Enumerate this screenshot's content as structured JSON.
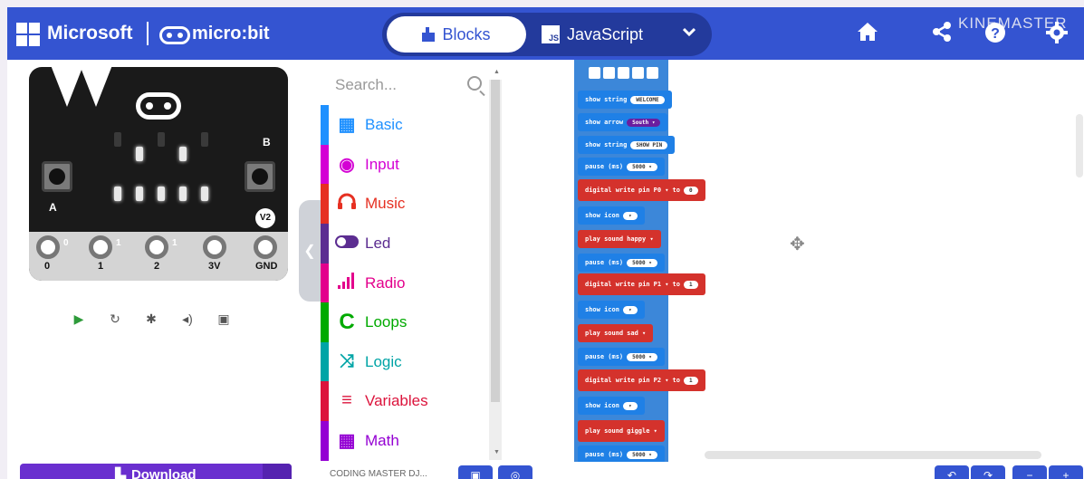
{
  "header": {
    "microsoft_label": "Microsoft",
    "microbit_label": "micro:bit",
    "tab_blocks": "Blocks",
    "tab_javascript": "JavaScript",
    "js_badge": "JS",
    "watermark": "KINEMASTER",
    "icons": [
      "home-icon",
      "share-icon",
      "help-icon",
      "settings-icon"
    ]
  },
  "simulator": {
    "btn_a": "A",
    "btn_b": "B",
    "version": "V2",
    "pins": [
      "0",
      "1",
      "2",
      "3V",
      "GND"
    ],
    "pin_small": [
      "0",
      "1",
      "1"
    ]
  },
  "toolbox": {
    "search_placeholder": "Search...",
    "categories": [
      {
        "label": "Basic",
        "color": "#1e90ff"
      },
      {
        "label": "Input",
        "color": "#d400d4"
      },
      {
        "label": "Music",
        "color": "#e63022"
      },
      {
        "label": "Led",
        "color": "#5c2d91"
      },
      {
        "label": "Radio",
        "color": "#e3008c"
      },
      {
        "label": "Loops",
        "color": "#00aa00"
      },
      {
        "label": "Logic",
        "color": "#00a4a6"
      },
      {
        "label": "Variables",
        "color": "#dc143c"
      },
      {
        "label": "Math",
        "color": "#9400d3"
      }
    ]
  },
  "workspace": {
    "blocks": [
      {
        "text": "show string",
        "value": "WELCOME"
      },
      {
        "text": "show arrow",
        "value": "South ▾"
      },
      {
        "text": "show string",
        "value": "SHOW PIN"
      },
      {
        "text": "pause (ms)",
        "value": "5000 ▾"
      },
      {
        "text": "digital write pin",
        "pin": "P0 ▾",
        "to": "to",
        "value": "0"
      },
      {
        "text": "show icon",
        "value": "▾"
      },
      {
        "text": "play sound",
        "value": "happy ▾"
      },
      {
        "text": "pause (ms)",
        "value": "5000 ▾"
      },
      {
        "text": "digital write pin",
        "pin": "P1 ▾",
        "to": "to",
        "value": "1"
      },
      {
        "text": "show icon",
        "value": "▾"
      },
      {
        "text": "play sound",
        "value": "sad ▾"
      },
      {
        "text": "pause (ms)",
        "value": "5000 ▾"
      },
      {
        "text": "digital write pin",
        "pin": "P2 ▾",
        "to": "to",
        "value": "1"
      },
      {
        "text": "show icon",
        "value": "▾"
      },
      {
        "text": "play sound",
        "value": "giggle ▾"
      },
      {
        "text": "pause (ms)",
        "value": "5000 ▾"
      }
    ]
  },
  "footer": {
    "download_label": "Download",
    "project_name": "CODING MASTER DJ..."
  }
}
